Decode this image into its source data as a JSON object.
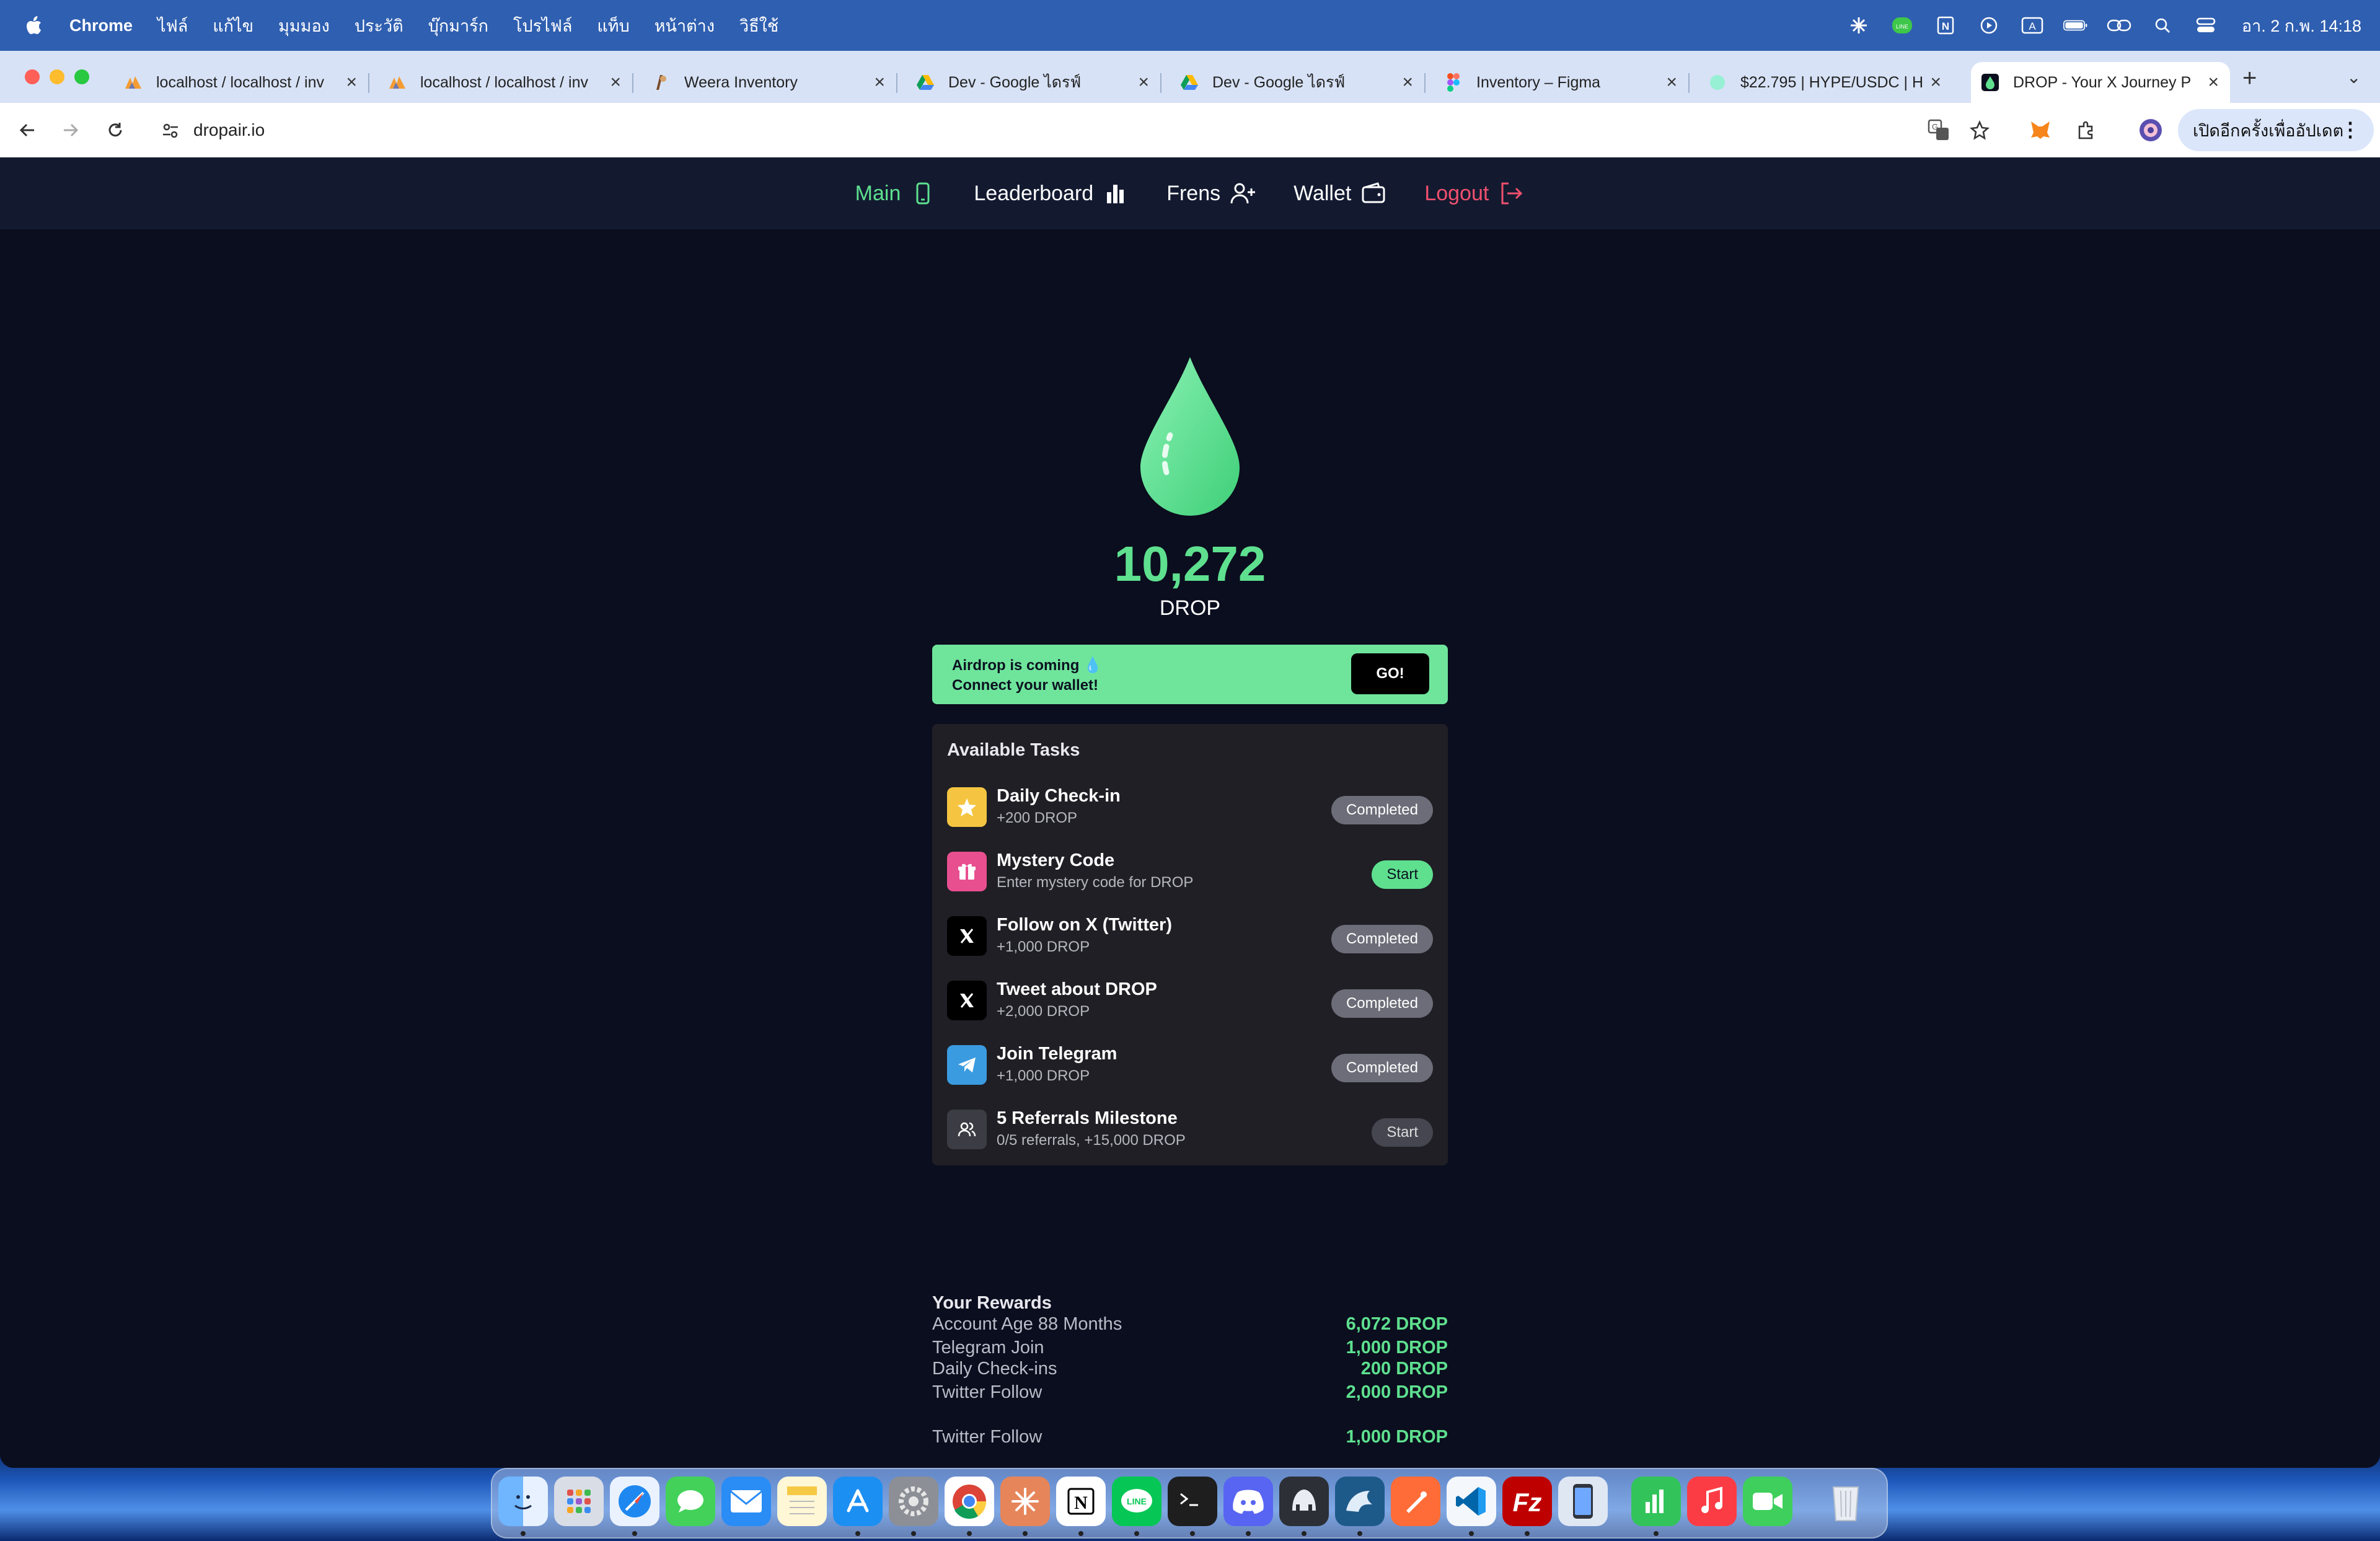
{
  "menubar": {
    "app_name": "Chrome",
    "items": [
      "ไฟล์",
      "แก้ไข",
      "มุมมอง",
      "ประวัติ",
      "บุ๊กมาร์ก",
      "โปรไฟล์",
      "แท็บ",
      "หน้าต่าง",
      "วิธีใช้"
    ],
    "clock": "อา. 2 ก.พ.  14:18",
    "status_icons": [
      "claude-icon",
      "line-icon",
      "notion-icon",
      "play-icon",
      "input-a-icon",
      "battery-icon",
      "link-icon",
      "spotlight-icon",
      "control-center-icon"
    ]
  },
  "tabs": [
    {
      "label": "localhost / localhost / inv",
      "icon": "phpmyadmin-icon"
    },
    {
      "label": "localhost / localhost / inv",
      "icon": "phpmyadmin-icon"
    },
    {
      "label": "Weera Inventory",
      "icon": "weera-icon"
    },
    {
      "label": "Dev - Google ไดรฟ์",
      "icon": "google-drive-icon"
    },
    {
      "label": "Dev - Google ไดรฟ์",
      "icon": "google-drive-icon"
    },
    {
      "label": "Inventory – Figma",
      "icon": "figma-icon"
    },
    {
      "label": "$22.795 | HYPE/USDC | H",
      "icon": "hype-icon"
    },
    {
      "label": "DROP - Your X Journey P",
      "icon": "drop-icon",
      "active": true
    }
  ],
  "toolbar": {
    "url": "dropair.io",
    "update_button": "เปิดอีกครั้งเพื่ออัปเดต"
  },
  "nav": {
    "main": "Main",
    "leaderboard": "Leaderboard",
    "frens": "Frens",
    "wallet": "Wallet",
    "logout": "Logout"
  },
  "balance": {
    "amount": "10,272",
    "currency": "DROP"
  },
  "banner": {
    "line1": "Airdrop is coming 💧",
    "line2": "Connect your wallet!",
    "button": "GO!"
  },
  "tasks": {
    "title": "Available Tasks",
    "items": [
      {
        "name": "Daily Check-in",
        "sub": "+200 DROP",
        "status": "Completed",
        "icon": "star-icon",
        "color": "#f5c542"
      },
      {
        "name": "Mystery Code",
        "sub": "Enter mystery code for DROP",
        "status": "Start",
        "icon": "gift-icon",
        "color": "#e84f8f"
      },
      {
        "name": "Follow on X (Twitter)",
        "sub": "+1,000 DROP",
        "status": "Completed",
        "icon": "x-logo-icon",
        "color": "#000000"
      },
      {
        "name": "Tweet about DROP",
        "sub": "+2,000 DROP",
        "status": "Completed",
        "icon": "x-logo-icon",
        "color": "#000000"
      },
      {
        "name": "Join Telegram",
        "sub": "+1,000 DROP",
        "status": "Completed",
        "icon": "telegram-icon",
        "color": "#3b9be0"
      },
      {
        "name": "5 Referrals Milestone",
        "sub": "0/5 referrals, +15,000 DROP",
        "status": "Start",
        "icon": "users-icon",
        "color": "#3c3d44"
      }
    ]
  },
  "rewards": {
    "title": "Your Rewards",
    "items": [
      {
        "label": "Telegram Join",
        "value": "1,000 DROP"
      },
      {
        "label": "Twitter Follow",
        "value": "2,000 DROP"
      },
      {
        "label": "Twitter Follow",
        "value": "1,000 DROP"
      },
      {
        "label": "Account Age 88 Months",
        "value": "6,072 DROP"
      },
      {
        "label": "Daily Check-ins",
        "value": "200 DROP"
      }
    ]
  },
  "dock": [
    "finder",
    "launchpad",
    "safari",
    "messages",
    "mail",
    "notes",
    "app-store",
    "system-settings",
    "chrome",
    "claude",
    "notion",
    "line",
    "terminal",
    "discord",
    "tableplus",
    "mysql-workbench",
    "postman",
    "vscode",
    "filezilla",
    "simulator",
    "numbers",
    "music",
    "facetime",
    "trash"
  ]
}
